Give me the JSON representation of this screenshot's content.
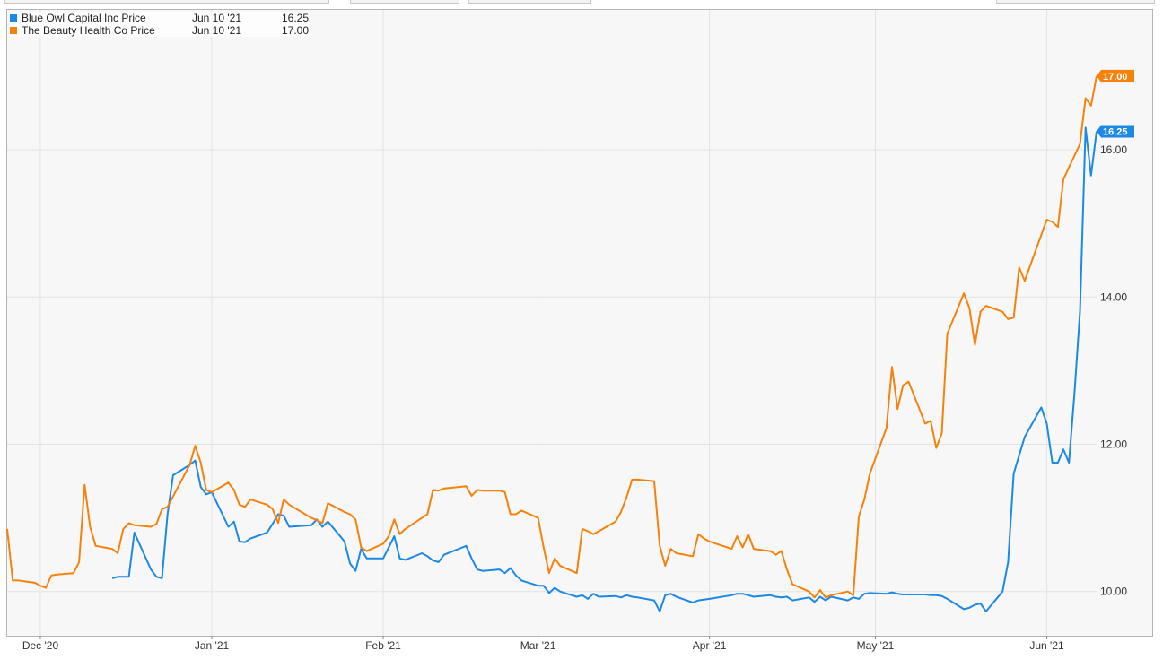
{
  "legend": [
    {
      "name": "Blue Owl Capital Inc Price",
      "date": "Jun 10 '21",
      "value": "16.25",
      "color": "#1e88e5"
    },
    {
      "name": "The Beauty Health Co Price",
      "date": "Jun 10 '21",
      "value": "17.00",
      "color": "#f5820d"
    }
  ],
  "chart_data": {
    "type": "line",
    "x_range": [
      "2020-11-25",
      "2021-06-10"
    ],
    "ylim": [
      9.4,
      17.9
    ],
    "y_ticks": [
      10,
      12,
      14,
      16
    ],
    "y_tick_labels": [
      "10.00",
      "12.00",
      "14.00",
      "16.00"
    ],
    "x_ticks": [
      {
        "date": "2020-12-01",
        "label": "Dec '20"
      },
      {
        "date": "2021-01-01",
        "label": "Jan '21"
      },
      {
        "date": "2021-02-01",
        "label": "Feb '21"
      },
      {
        "date": "2021-03-01",
        "label": "Mar '21"
      },
      {
        "date": "2021-04-01",
        "label": "Apr '21"
      },
      {
        "date": "2021-05-01",
        "label": "May '21"
      },
      {
        "date": "2021-06-01",
        "label": "Jun '21"
      }
    ],
    "grid": true,
    "legend_position": "top-left",
    "series": [
      {
        "name": "Blue Owl Capital Inc Price",
        "color": "#1e88e5",
        "last_label": "16.25",
        "points": [
          [
            "2020-12-14",
            10.18
          ],
          [
            "2020-12-15",
            10.2
          ],
          [
            "2020-12-17",
            10.2
          ],
          [
            "2020-12-18",
            10.8
          ],
          [
            "2020-12-21",
            10.3
          ],
          [
            "2020-12-22",
            10.2
          ],
          [
            "2020-12-23",
            10.18
          ],
          [
            "2020-12-24",
            11.05
          ],
          [
            "2020-12-25",
            11.58
          ],
          [
            "2020-12-28",
            11.72
          ],
          [
            "2020-12-29",
            11.78
          ],
          [
            "2020-12-30",
            11.42
          ],
          [
            "2020-12-31",
            11.32
          ],
          [
            "2021-01-01",
            11.35
          ],
          [
            "2021-01-04",
            10.88
          ],
          [
            "2021-01-05",
            10.95
          ],
          [
            "2021-01-06",
            10.68
          ],
          [
            "2021-01-07",
            10.67
          ],
          [
            "2021-01-08",
            10.72
          ],
          [
            "2021-01-11",
            10.8
          ],
          [
            "2021-01-12",
            10.92
          ],
          [
            "2021-01-13",
            11.05
          ],
          [
            "2021-01-14",
            11.03
          ],
          [
            "2021-01-15",
            10.88
          ],
          [
            "2021-01-19",
            10.9
          ],
          [
            "2021-01-20",
            10.98
          ],
          [
            "2021-01-21",
            10.88
          ],
          [
            "2021-01-22",
            10.95
          ],
          [
            "2021-01-25",
            10.68
          ],
          [
            "2021-01-26",
            10.38
          ],
          [
            "2021-01-27",
            10.28
          ],
          [
            "2021-01-28",
            10.58
          ],
          [
            "2021-01-29",
            10.45
          ],
          [
            "2021-02-01",
            10.45
          ],
          [
            "2021-02-02",
            10.6
          ],
          [
            "2021-02-03",
            10.75
          ],
          [
            "2021-02-04",
            10.45
          ],
          [
            "2021-02-05",
            10.43
          ],
          [
            "2021-02-08",
            10.52
          ],
          [
            "2021-02-09",
            10.48
          ],
          [
            "2021-02-10",
            10.42
          ],
          [
            "2021-02-11",
            10.4
          ],
          [
            "2021-02-12",
            10.5
          ],
          [
            "2021-02-16",
            10.62
          ],
          [
            "2021-02-17",
            10.45
          ],
          [
            "2021-02-18",
            10.3
          ],
          [
            "2021-02-19",
            10.28
          ],
          [
            "2021-02-22",
            10.3
          ],
          [
            "2021-02-23",
            10.25
          ],
          [
            "2021-02-24",
            10.32
          ],
          [
            "2021-02-25",
            10.22
          ],
          [
            "2021-02-26",
            10.15
          ],
          [
            "2021-03-01",
            10.08
          ],
          [
            "2021-03-02",
            10.08
          ],
          [
            "2021-03-03",
            9.98
          ],
          [
            "2021-03-04",
            10.05
          ],
          [
            "2021-03-05",
            10.0
          ],
          [
            "2021-03-08",
            9.93
          ],
          [
            "2021-03-09",
            9.95
          ],
          [
            "2021-03-10",
            9.9
          ],
          [
            "2021-03-11",
            9.97
          ],
          [
            "2021-03-12",
            9.93
          ],
          [
            "2021-03-15",
            9.94
          ],
          [
            "2021-03-16",
            9.92
          ],
          [
            "2021-03-17",
            9.95
          ],
          [
            "2021-03-18",
            9.93
          ],
          [
            "2021-03-19",
            9.92
          ],
          [
            "2021-03-22",
            9.88
          ],
          [
            "2021-03-23",
            9.73
          ],
          [
            "2021-03-24",
            9.95
          ],
          [
            "2021-03-25",
            9.97
          ],
          [
            "2021-03-26",
            9.93
          ],
          [
            "2021-03-29",
            9.85
          ],
          [
            "2021-03-30",
            9.88
          ],
          [
            "2021-04-01",
            9.9
          ],
          [
            "2021-04-05",
            9.95
          ],
          [
            "2021-04-06",
            9.97
          ],
          [
            "2021-04-07",
            9.97
          ],
          [
            "2021-04-08",
            9.95
          ],
          [
            "2021-04-09",
            9.93
          ],
          [
            "2021-04-12",
            9.95
          ],
          [
            "2021-04-13",
            9.93
          ],
          [
            "2021-04-14",
            9.92
          ],
          [
            "2021-04-15",
            9.93
          ],
          [
            "2021-04-16",
            9.88
          ],
          [
            "2021-04-19",
            9.92
          ],
          [
            "2021-04-20",
            9.86
          ],
          [
            "2021-04-21",
            9.93
          ],
          [
            "2021-04-22",
            9.88
          ],
          [
            "2021-04-23",
            9.93
          ],
          [
            "2021-04-26",
            9.88
          ],
          [
            "2021-04-27",
            9.92
          ],
          [
            "2021-04-28",
            9.9
          ],
          [
            "2021-04-29",
            9.97
          ],
          [
            "2021-04-30",
            9.98
          ],
          [
            "2021-05-03",
            9.97
          ],
          [
            "2021-05-04",
            9.99
          ],
          [
            "2021-05-05",
            9.97
          ],
          [
            "2021-05-06",
            9.96
          ],
          [
            "2021-05-07",
            9.96
          ],
          [
            "2021-05-10",
            9.96
          ],
          [
            "2021-05-11",
            9.95
          ],
          [
            "2021-05-12",
            9.95
          ],
          [
            "2021-05-13",
            9.94
          ],
          [
            "2021-05-14",
            9.9
          ],
          [
            "2021-05-17",
            9.76
          ],
          [
            "2021-05-18",
            9.78
          ],
          [
            "2021-05-19",
            9.82
          ],
          [
            "2021-05-20",
            9.84
          ],
          [
            "2021-05-21",
            9.73
          ],
          [
            "2021-05-24",
            10.0
          ],
          [
            "2021-05-25",
            10.4
          ],
          [
            "2021-05-26",
            11.6
          ],
          [
            "2021-05-27",
            11.85
          ],
          [
            "2021-05-28",
            12.1
          ],
          [
            "2021-05-31",
            12.5
          ],
          [
            "2021-06-01",
            12.28
          ],
          [
            "2021-06-02",
            11.75
          ],
          [
            "2021-06-03",
            11.75
          ],
          [
            "2021-06-04",
            11.93
          ],
          [
            "2021-06-05",
            11.75
          ],
          [
            "2021-06-06",
            12.7
          ],
          [
            "2021-06-07",
            13.8
          ],
          [
            "2021-06-08",
            16.3
          ],
          [
            "2021-06-09",
            15.65
          ],
          [
            "2021-06-10",
            16.25
          ]
        ]
      },
      {
        "name": "The Beauty Health Co Price",
        "color": "#f5820d",
        "last_label": "17.00",
        "points": [
          [
            "2020-11-25",
            10.85
          ],
          [
            "2020-11-26",
            10.15
          ],
          [
            "2020-11-27",
            10.15
          ],
          [
            "2020-11-30",
            10.12
          ],
          [
            "2020-12-01",
            10.08
          ],
          [
            "2020-12-02",
            10.05
          ],
          [
            "2020-12-03",
            10.22
          ],
          [
            "2020-12-04",
            10.23
          ],
          [
            "2020-12-07",
            10.25
          ],
          [
            "2020-12-08",
            10.4
          ],
          [
            "2020-12-09",
            11.45
          ],
          [
            "2020-12-10",
            10.88
          ],
          [
            "2020-12-11",
            10.62
          ],
          [
            "2020-12-14",
            10.58
          ],
          [
            "2020-12-15",
            10.52
          ],
          [
            "2020-12-16",
            10.85
          ],
          [
            "2020-12-17",
            10.93
          ],
          [
            "2020-12-18",
            10.9
          ],
          [
            "2020-12-21",
            10.88
          ],
          [
            "2020-12-22",
            10.92
          ],
          [
            "2020-12-23",
            11.12
          ],
          [
            "2020-12-24",
            11.15
          ],
          [
            "2020-12-28",
            11.72
          ],
          [
            "2020-12-29",
            11.98
          ],
          [
            "2020-12-30",
            11.75
          ],
          [
            "2020-12-31",
            11.38
          ],
          [
            "2021-01-01",
            11.35
          ],
          [
            "2021-01-04",
            11.48
          ],
          [
            "2021-01-05",
            11.38
          ],
          [
            "2021-01-06",
            11.18
          ],
          [
            "2021-01-07",
            11.15
          ],
          [
            "2021-01-08",
            11.25
          ],
          [
            "2021-01-11",
            11.18
          ],
          [
            "2021-01-12",
            11.12
          ],
          [
            "2021-01-13",
            10.93
          ],
          [
            "2021-01-14",
            11.25
          ],
          [
            "2021-01-15",
            11.18
          ],
          [
            "2021-01-19",
            11.0
          ],
          [
            "2021-01-20",
            10.97
          ],
          [
            "2021-01-21",
            10.93
          ],
          [
            "2021-01-22",
            11.2
          ],
          [
            "2021-01-25",
            11.08
          ],
          [
            "2021-01-26",
            11.05
          ],
          [
            "2021-01-27",
            10.98
          ],
          [
            "2021-01-28",
            10.6
          ],
          [
            "2021-01-29",
            10.55
          ],
          [
            "2021-02-01",
            10.65
          ],
          [
            "2021-02-02",
            10.75
          ],
          [
            "2021-02-03",
            10.98
          ],
          [
            "2021-02-04",
            10.78
          ],
          [
            "2021-02-05",
            10.85
          ],
          [
            "2021-02-08",
            11.0
          ],
          [
            "2021-02-09",
            11.05
          ],
          [
            "2021-02-10",
            11.38
          ],
          [
            "2021-02-11",
            11.37
          ],
          [
            "2021-02-12",
            11.4
          ],
          [
            "2021-02-16",
            11.43
          ],
          [
            "2021-02-17",
            11.3
          ],
          [
            "2021-02-18",
            11.38
          ],
          [
            "2021-02-19",
            11.37
          ],
          [
            "2021-02-22",
            11.37
          ],
          [
            "2021-02-23",
            11.35
          ],
          [
            "2021-02-24",
            11.05
          ],
          [
            "2021-02-25",
            11.05
          ],
          [
            "2021-02-26",
            11.1
          ],
          [
            "2021-03-01",
            11.0
          ],
          [
            "2021-03-02",
            10.6
          ],
          [
            "2021-03-03",
            10.25
          ],
          [
            "2021-03-04",
            10.45
          ],
          [
            "2021-03-05",
            10.35
          ],
          [
            "2021-03-08",
            10.25
          ],
          [
            "2021-03-09",
            10.85
          ],
          [
            "2021-03-10",
            10.82
          ],
          [
            "2021-03-11",
            10.78
          ],
          [
            "2021-03-12",
            10.82
          ],
          [
            "2021-03-15",
            10.95
          ],
          [
            "2021-03-16",
            11.08
          ],
          [
            "2021-03-17",
            11.28
          ],
          [
            "2021-03-18",
            11.52
          ],
          [
            "2021-03-19",
            11.52
          ],
          [
            "2021-03-22",
            11.5
          ],
          [
            "2021-03-23",
            10.62
          ],
          [
            "2021-03-24",
            10.35
          ],
          [
            "2021-03-25",
            10.58
          ],
          [
            "2021-03-26",
            10.52
          ],
          [
            "2021-03-29",
            10.48
          ],
          [
            "2021-03-30",
            10.78
          ],
          [
            "2021-03-31",
            10.72
          ],
          [
            "2021-04-01",
            10.68
          ],
          [
            "2021-04-05",
            10.58
          ],
          [
            "2021-04-06",
            10.75
          ],
          [
            "2021-04-07",
            10.6
          ],
          [
            "2021-04-08",
            10.78
          ],
          [
            "2021-04-09",
            10.58
          ],
          [
            "2021-04-12",
            10.55
          ],
          [
            "2021-04-13",
            10.5
          ],
          [
            "2021-04-14",
            10.55
          ],
          [
            "2021-04-15",
            10.3
          ],
          [
            "2021-04-16",
            10.1
          ],
          [
            "2021-04-19",
            10.0
          ],
          [
            "2021-04-20",
            9.92
          ],
          [
            "2021-04-21",
            10.02
          ],
          [
            "2021-04-22",
            9.92
          ],
          [
            "2021-04-23",
            9.95
          ],
          [
            "2021-04-26",
            10.0
          ],
          [
            "2021-04-27",
            9.95
          ],
          [
            "2021-04-28",
            11.02
          ],
          [
            "2021-04-29",
            11.25
          ],
          [
            "2021-04-30",
            11.6
          ],
          [
            "2021-05-03",
            12.22
          ],
          [
            "2021-05-04",
            13.05
          ],
          [
            "2021-05-05",
            12.48
          ],
          [
            "2021-05-06",
            12.8
          ],
          [
            "2021-05-07",
            12.85
          ],
          [
            "2021-05-10",
            12.28
          ],
          [
            "2021-05-11",
            12.32
          ],
          [
            "2021-05-12",
            11.95
          ],
          [
            "2021-05-13",
            12.15
          ],
          [
            "2021-05-14",
            13.5
          ],
          [
            "2021-05-17",
            14.05
          ],
          [
            "2021-05-18",
            13.85
          ],
          [
            "2021-05-19",
            13.35
          ],
          [
            "2021-05-20",
            13.8
          ],
          [
            "2021-05-21",
            13.88
          ],
          [
            "2021-05-24",
            13.8
          ],
          [
            "2021-05-25",
            13.7
          ],
          [
            "2021-05-26",
            13.72
          ],
          [
            "2021-05-27",
            14.4
          ],
          [
            "2021-05-28",
            14.22
          ],
          [
            "2021-06-01",
            15.05
          ],
          [
            "2021-06-02",
            15.02
          ],
          [
            "2021-06-03",
            14.95
          ],
          [
            "2021-06-04",
            15.6
          ],
          [
            "2021-06-07",
            16.08
          ],
          [
            "2021-06-08",
            16.7
          ],
          [
            "2021-06-09",
            16.6
          ],
          [
            "2021-06-10",
            17.0
          ]
        ]
      }
    ]
  }
}
